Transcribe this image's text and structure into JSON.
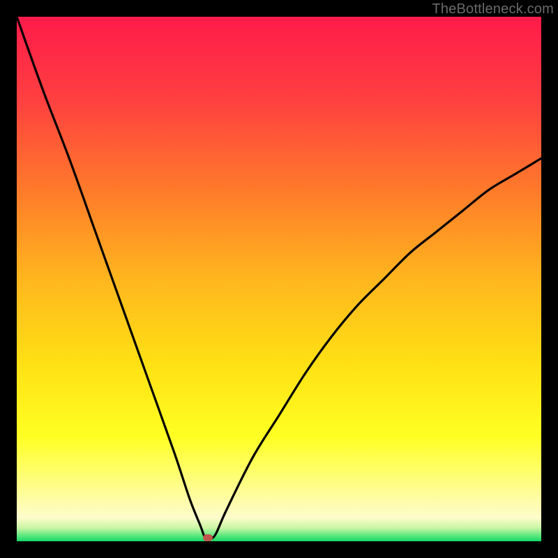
{
  "watermark": "TheBottleneck.com",
  "chart_data": {
    "type": "line",
    "title": "",
    "xlabel": "",
    "ylabel": "",
    "xlim": [
      0,
      100
    ],
    "ylim": [
      0,
      100
    ],
    "grid": false,
    "legend": false,
    "series": [
      {
        "name": "curve",
        "x": [
          0,
          5,
          10,
          15,
          20,
          25,
          30,
          33,
          35,
          36,
          37,
          38,
          40,
          45,
          50,
          55,
          60,
          65,
          70,
          75,
          80,
          85,
          90,
          95,
          100
        ],
        "y": [
          100,
          86,
          73,
          59,
          45,
          31,
          17,
          8,
          3,
          0.5,
          0.5,
          1.5,
          6,
          16,
          24,
          32,
          39,
          45,
          50,
          55,
          59,
          63,
          67,
          70,
          73
        ]
      }
    ],
    "marker": {
      "x": 36.5,
      "y": 0.6
    },
    "gradient_stops": [
      {
        "pos": 0.0,
        "color": "#ff1b4a"
      },
      {
        "pos": 0.16,
        "color": "#ff4040"
      },
      {
        "pos": 0.33,
        "color": "#ff7a2a"
      },
      {
        "pos": 0.5,
        "color": "#ffb61e"
      },
      {
        "pos": 0.66,
        "color": "#ffe014"
      },
      {
        "pos": 0.8,
        "color": "#ffff22"
      },
      {
        "pos": 0.9,
        "color": "#fffd8f"
      },
      {
        "pos": 0.955,
        "color": "#fdfccc"
      },
      {
        "pos": 0.975,
        "color": "#c8f5a4"
      },
      {
        "pos": 0.99,
        "color": "#56e77c"
      },
      {
        "pos": 1.0,
        "color": "#17d765"
      }
    ]
  }
}
